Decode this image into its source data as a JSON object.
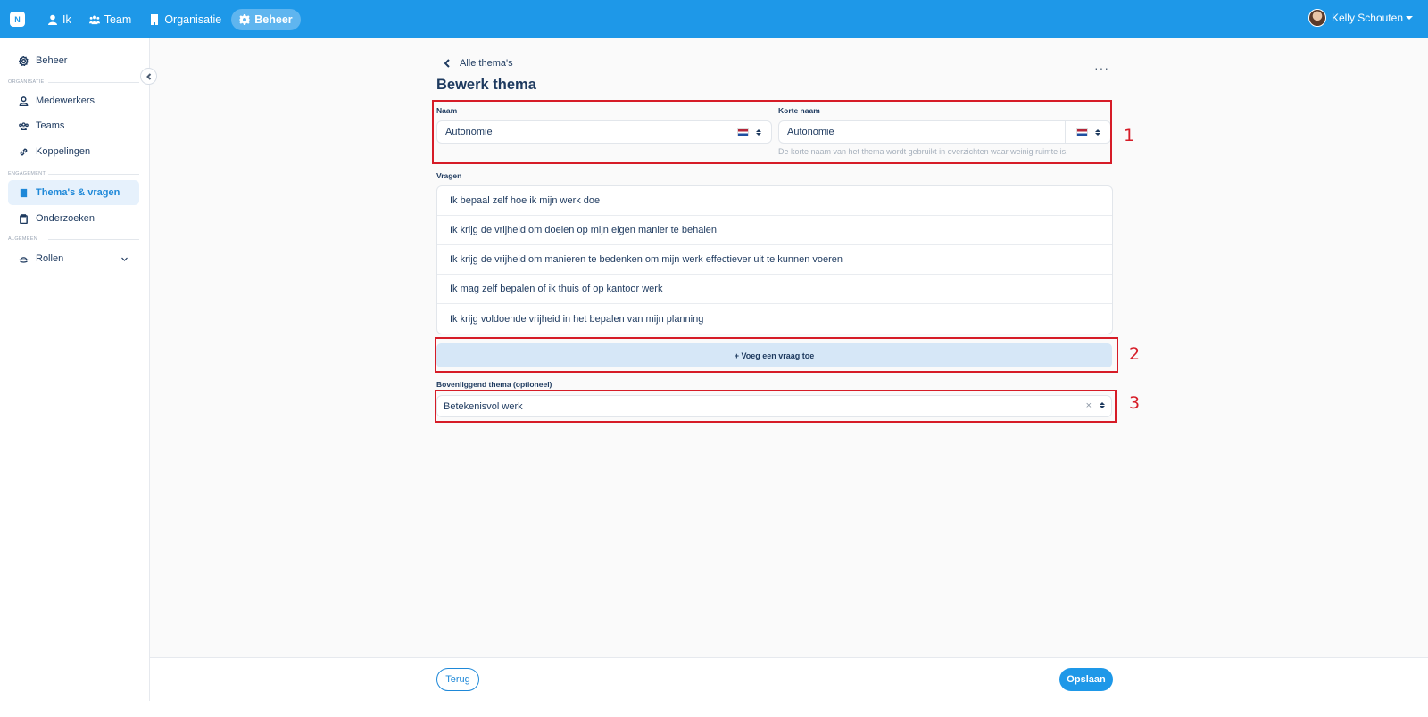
{
  "topbar": {
    "logo": "N",
    "nav": [
      {
        "label": "Ik",
        "icon": "user-icon"
      },
      {
        "label": "Team",
        "icon": "team-icon"
      },
      {
        "label": "Organisatie",
        "icon": "building-icon"
      },
      {
        "label": "Beheer",
        "icon": "gear-icon",
        "active": true
      }
    ],
    "user_name": "Kelly Schouten",
    "color": "#1e98e8"
  },
  "sidebar": {
    "beheer": "Beheer",
    "section_organisatie": "ORGANISATIE",
    "medewerkers": "Medewerkers",
    "teams": "Teams",
    "koppelingen": "Koppelingen",
    "section_engagement": "ENGAGEMENT",
    "themas": "Thema's & vragen",
    "onderzoeken": "Onderzoeken",
    "section_algemeen": "ALGEMEEN",
    "rollen": "Rollen"
  },
  "main": {
    "back_link": "Alle thema's",
    "title": "Bewerk thema",
    "more": "···",
    "naam_label": "Naam",
    "naam_value": "Autonomie",
    "korte_naam_label": "Korte naam",
    "korte_naam_value": "Autonomie",
    "korte_naam_help": "De korte naam van het thema wordt gebruikt in overzichten waar weinig ruimte is.",
    "vragen_label": "Vragen",
    "vragen": [
      "Ik bepaal zelf hoe ik mijn werk doe",
      "Ik krijg de vrijheid om doelen op mijn eigen manier te behalen",
      "Ik krijg de vrijheid om manieren te bedenken om mijn werk effectiever uit te kunnen voeren",
      "Ik mag zelf bepalen of ik thuis of op kantoor werk",
      "Ik krijg voldoende vrijheid in het bepalen van mijn planning"
    ],
    "add_question": "+ Voeg een vraag toe",
    "parent_label": "Bovenliggend thema (optioneel)",
    "parent_value": "Betekenisvol werk",
    "clear": "×"
  },
  "annotations": [
    "1",
    "2",
    "3"
  ],
  "footer": {
    "back": "Terug",
    "save": "Opslaan"
  }
}
